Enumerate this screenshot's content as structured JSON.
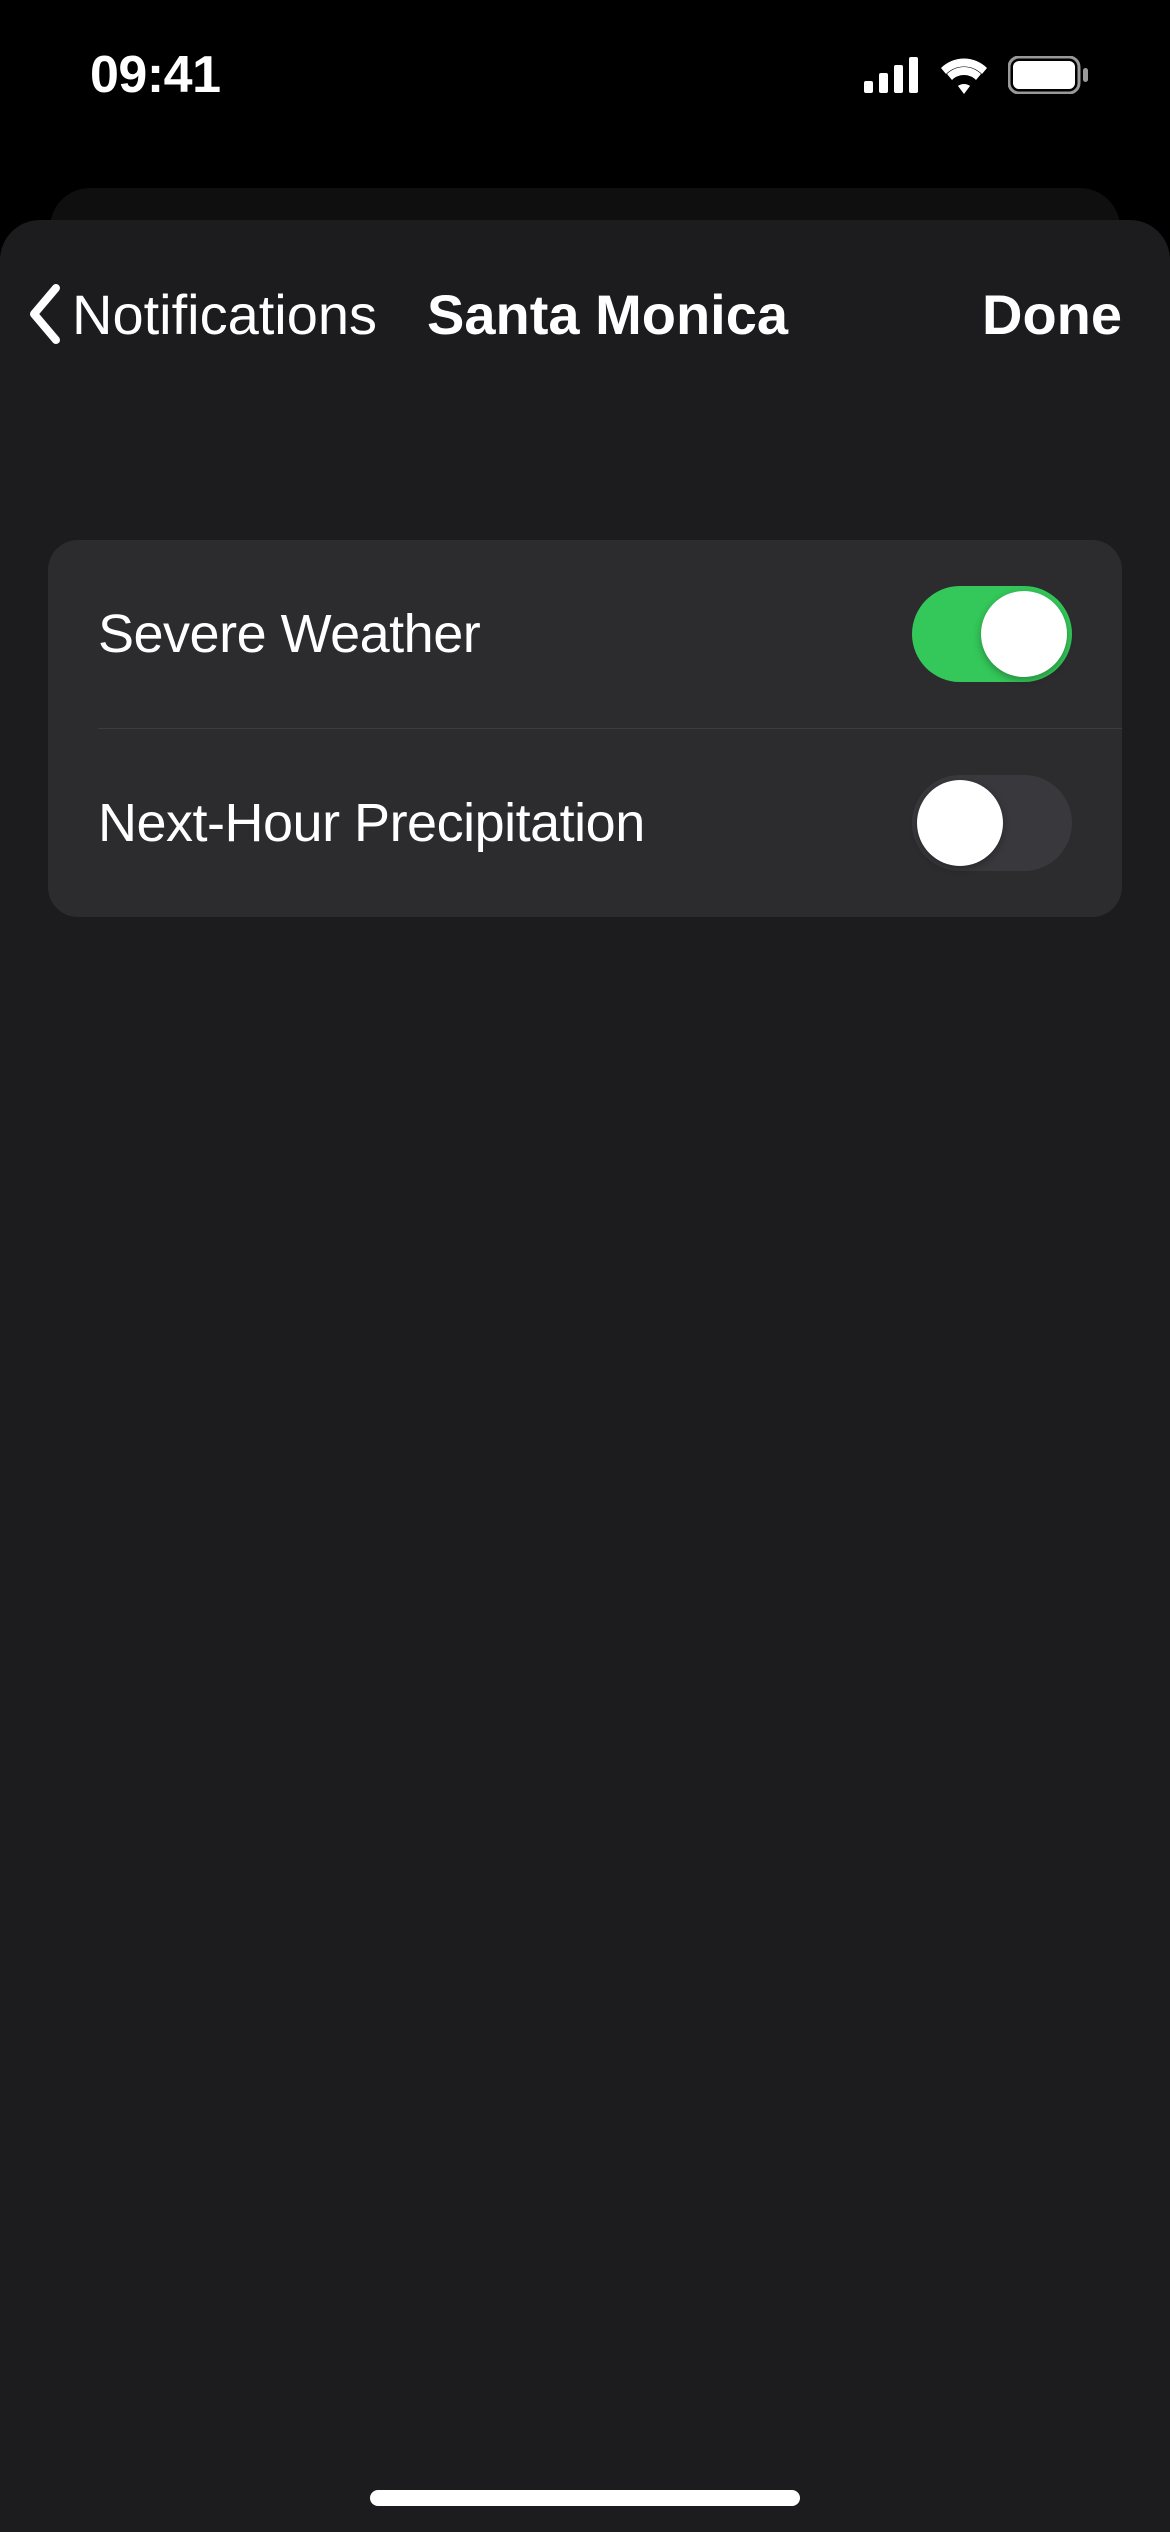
{
  "statusBar": {
    "time": "09:41"
  },
  "nav": {
    "back_label": "Notifications",
    "title": "Santa Monica",
    "done_label": "Done"
  },
  "settings": {
    "rows": [
      {
        "label": "Severe Weather",
        "on": true
      },
      {
        "label": "Next-Hour Precipitation",
        "on": false
      }
    ]
  },
  "colors": {
    "toggle_on": "#34c759",
    "toggle_off": "#39393d",
    "sheet_bg": "#1c1c1e",
    "group_bg": "#2c2c2e"
  }
}
